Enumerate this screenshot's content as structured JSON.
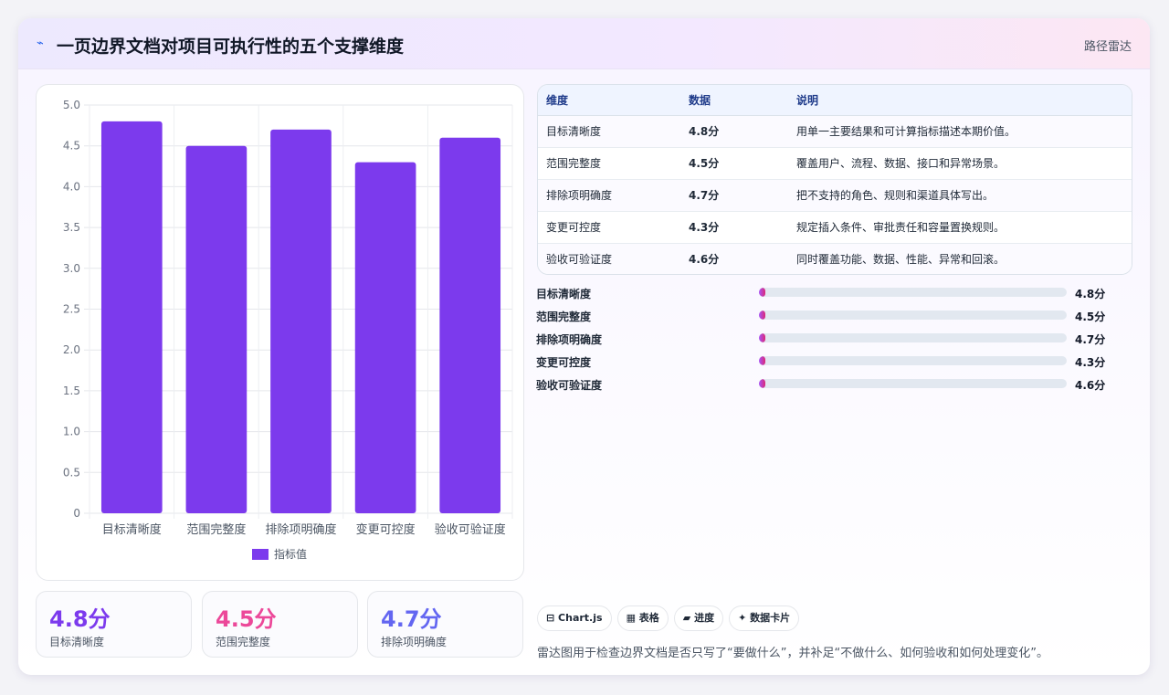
{
  "header": {
    "icon": "⌁",
    "title": "一页边界文档对项目可执行性的五个支撑维度",
    "tag": "路径雷达"
  },
  "chart_data": {
    "type": "bar",
    "categories": [
      "目标清晰度",
      "范围完整度",
      "排除项明确度",
      "变更可控度",
      "验收可验证度"
    ],
    "series": [
      {
        "name": "指标值",
        "values": [
          4.8,
          4.5,
          4.7,
          4.3,
          4.6
        ]
      }
    ],
    "ylim": [
      0,
      5
    ],
    "yticks": [
      "0",
      "0.5",
      "1.0",
      "1.5",
      "2.0",
      "2.5",
      "3.0",
      "3.5",
      "4.0",
      "4.5",
      "5.0"
    ],
    "grid": true,
    "legend": "bottom",
    "color": "#7c3aed"
  },
  "metrics": [
    {
      "value": "4.8分",
      "label": "目标清晰度",
      "color": "#7c3aed"
    },
    {
      "value": "4.5分",
      "label": "范围完整度",
      "color": "#ec4899"
    },
    {
      "value": "4.7分",
      "label": "排除项明确度",
      "color": "#6366f1"
    }
  ],
  "table": {
    "headers": [
      "维度",
      "数据",
      "说明"
    ],
    "rows": [
      [
        "目标清晰度",
        "4.8分",
        "用单一主要结果和可计算指标描述本期价值。"
      ],
      [
        "范围完整度",
        "4.5分",
        "覆盖用户、流程、数据、接口和异常场景。"
      ],
      [
        "排除项明确度",
        "4.7分",
        "把不支持的角色、规则和渠道具体写出。"
      ],
      [
        "变更可控度",
        "4.3分",
        "规定插入条件、审批责任和容量置换规则。"
      ],
      [
        "验收可验证度",
        "4.6分",
        "同时覆盖功能、数据、性能、异常和回滚。"
      ]
    ]
  },
  "progress": [
    {
      "label": "目标清晰度",
      "value_text": "4.8分",
      "fraction": 0.02
    },
    {
      "label": "范围完整度",
      "value_text": "4.5分",
      "fraction": 0.02
    },
    {
      "label": "排除项明确度",
      "value_text": "4.7分",
      "fraction": 0.02
    },
    {
      "label": "变更可控度",
      "value_text": "4.3分",
      "fraction": 0.02
    },
    {
      "label": "验收可验证度",
      "value_text": "4.6分",
      "fraction": 0.02
    }
  ],
  "chips": [
    "⊟ Chart.js",
    "▦ 表格",
    "▰ 进度",
    "✦ 数据卡片"
  ],
  "footnote": "雷达图用于检查边界文档是否只写了“要做什么”，并补足“不做什么、如何验收和如何处理变化”。"
}
